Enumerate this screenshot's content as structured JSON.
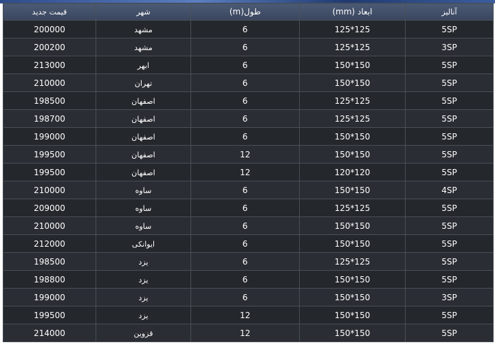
{
  "table": {
    "headers": {
      "analysis": "آنالیز",
      "dimensions": "ابعاد (mm)",
      "length": "طول(m)",
      "city": "شهر",
      "price": "قیمت جدید"
    },
    "rows": [
      {
        "analysis": "5SP",
        "dimensions": "125*125",
        "length": "6",
        "city": "مشهد",
        "price": "200000"
      },
      {
        "analysis": "3SP",
        "dimensions": "125*125",
        "length": "6",
        "city": "مشهد",
        "price": "200200"
      },
      {
        "analysis": "5SP",
        "dimensions": "150*150",
        "length": "6",
        "city": "ابهر",
        "price": "213000"
      },
      {
        "analysis": "5SP",
        "dimensions": "150*150",
        "length": "6",
        "city": "تهران",
        "price": "210000"
      },
      {
        "analysis": "5SP",
        "dimensions": "125*125",
        "length": "6",
        "city": "اصفهان",
        "price": "198500"
      },
      {
        "analysis": "5SP",
        "dimensions": "125*125",
        "length": "6",
        "city": "اصفهان",
        "price": "198700"
      },
      {
        "analysis": "5SP",
        "dimensions": "150*150",
        "length": "6",
        "city": "اصفهان",
        "price": "199000"
      },
      {
        "analysis": "5SP",
        "dimensions": "150*150",
        "length": "12",
        "city": "اصفهان",
        "price": "199500"
      },
      {
        "analysis": "5SP",
        "dimensions": "120*120",
        "length": "12",
        "city": "اصفهان",
        "price": "199500"
      },
      {
        "analysis": "4SP",
        "dimensions": "150*150",
        "length": "6",
        "city": "ساوه",
        "price": "210000"
      },
      {
        "analysis": "5SP",
        "dimensions": "125*125",
        "length": "6",
        "city": "ساوه",
        "price": "209000"
      },
      {
        "analysis": "5SP",
        "dimensions": "150*150",
        "length": "6",
        "city": "ساوه",
        "price": "210000"
      },
      {
        "analysis": "5SP",
        "dimensions": "150*150",
        "length": "6",
        "city": "ایوانکی",
        "price": "212000"
      },
      {
        "analysis": "5SP",
        "dimensions": "125*125",
        "length": "6",
        "city": "یزد",
        "price": "198500"
      },
      {
        "analysis": "5SP",
        "dimensions": "150*150",
        "length": "6",
        "city": "یزد",
        "price": "198800"
      },
      {
        "analysis": "3SP",
        "dimensions": "150*150",
        "length": "6",
        "city": "یزد",
        "price": "199000"
      },
      {
        "analysis": "5SP",
        "dimensions": "150*150",
        "length": "12",
        "city": "یزد",
        "price": "199500"
      },
      {
        "analysis": "5SP",
        "dimensions": "150*150",
        "length": "12",
        "city": "قزوین",
        "price": "214000"
      }
    ]
  }
}
